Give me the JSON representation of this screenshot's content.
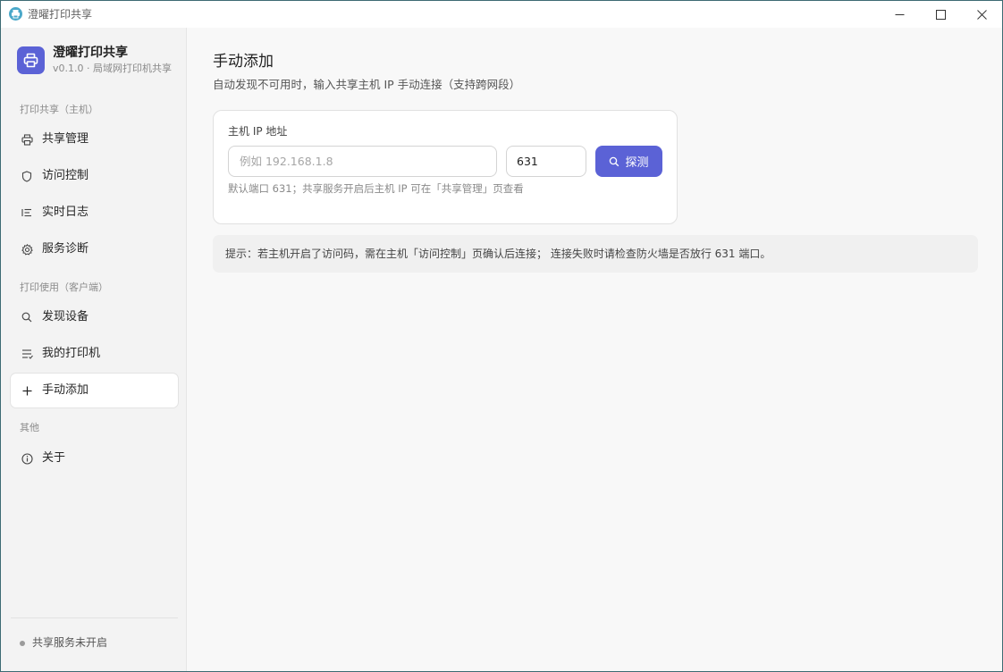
{
  "window": {
    "title": "澄曜打印共享",
    "icon": "printer-app-icon"
  },
  "brand": {
    "name": "澄曜打印共享",
    "subtitle": "v0.1.0 · 局域网打印机共享",
    "icon": "printer-icon",
    "accent_color": "#5b62d6"
  },
  "sidebar": {
    "sections": [
      {
        "label": "打印共享（主机）",
        "items": [
          {
            "label": "共享管理",
            "icon": "printer-icon"
          },
          {
            "label": "访问控制",
            "icon": "shield-icon"
          },
          {
            "label": "实时日志",
            "icon": "list-icon"
          },
          {
            "label": "服务诊断",
            "icon": "gear-icon"
          }
        ]
      },
      {
        "label": "打印使用（客户端）",
        "items": [
          {
            "label": "发现设备",
            "icon": "search-icon"
          },
          {
            "label": "我的打印机",
            "icon": "list-check-icon"
          },
          {
            "label": "手动添加",
            "icon": "plus-icon",
            "active": true
          }
        ]
      },
      {
        "label": "其他",
        "items": [
          {
            "label": "关于",
            "icon": "info-icon"
          }
        ]
      }
    ],
    "status_text": "共享服务未开启",
    "status_color": "#9b9b9b"
  },
  "main": {
    "title": "手动添加",
    "subtitle": "自动发现不可用时，输入共享主机 IP 手动连接（支持跨网段）",
    "form": {
      "ip_label": "主机 IP 地址",
      "ip_placeholder": "例如 192.168.1.8",
      "ip_value": "",
      "port_value": "631",
      "probe_label": "探测",
      "hint": "默认端口 631；共享服务开启后主机 IP 可在「共享管理」页查看"
    },
    "tip": "提示：若主机开启了访问码，需在主机「访问控制」页确认后连接； 连接失败时请检查防火墙是否放行 631 端口。"
  }
}
